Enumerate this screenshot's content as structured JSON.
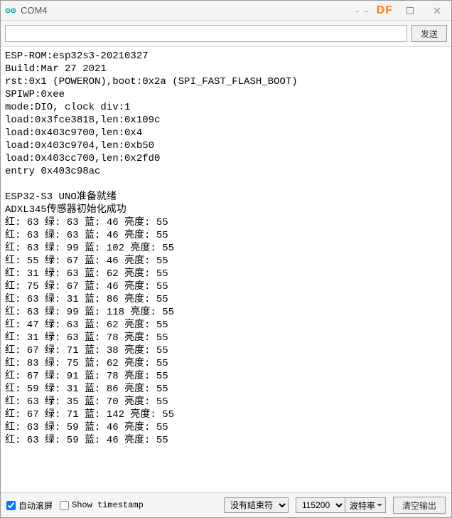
{
  "window": {
    "title": "COM4",
    "watermark": "DF",
    "dashes": "- -"
  },
  "sendRow": {
    "inputValue": "",
    "placeholder": "",
    "sendLabel": "发送"
  },
  "console": {
    "bootLines": [
      "ESP-ROM:esp32s3-20210327",
      "Build:Mar 27 2021",
      "rst:0x1 (POWERON),boot:0x2a (SPI_FAST_FLASH_BOOT)",
      "SPIWP:0xee",
      "mode:DIO, clock div:1",
      "load:0x3fce3818,len:0x109c",
      "load:0x403c9700,len:0x4",
      "load:0x403c9704,len:0xb50",
      "load:0x403cc700,len:0x2fd0",
      "entry 0x403c98ac",
      "",
      "ESP32-S3 UNO准备就绪",
      "ADXL345传感器初始化成功"
    ],
    "labels": {
      "r": "红:",
      "g": "绿:",
      "b": "蓝:",
      "l": "亮度:"
    },
    "readings": [
      {
        "r": 63,
        "g": 63,
        "b": 46,
        "l": 55
      },
      {
        "r": 63,
        "g": 63,
        "b": 46,
        "l": 55
      },
      {
        "r": 63,
        "g": 99,
        "b": 102,
        "l": 55
      },
      {
        "r": 55,
        "g": 67,
        "b": 46,
        "l": 55
      },
      {
        "r": 31,
        "g": 63,
        "b": 62,
        "l": 55
      },
      {
        "r": 75,
        "g": 67,
        "b": 46,
        "l": 55
      },
      {
        "r": 63,
        "g": 31,
        "b": 86,
        "l": 55
      },
      {
        "r": 63,
        "g": 99,
        "b": 118,
        "l": 55
      },
      {
        "r": 47,
        "g": 63,
        "b": 62,
        "l": 55
      },
      {
        "r": 31,
        "g": 63,
        "b": 78,
        "l": 55
      },
      {
        "r": 67,
        "g": 71,
        "b": 38,
        "l": 55
      },
      {
        "r": 83,
        "g": 75,
        "b": 62,
        "l": 55
      },
      {
        "r": 67,
        "g": 91,
        "b": 78,
        "l": 55
      },
      {
        "r": 59,
        "g": 31,
        "b": 86,
        "l": 55
      },
      {
        "r": 63,
        "g": 35,
        "b": 70,
        "l": 55
      },
      {
        "r": 67,
        "g": 71,
        "b": 142,
        "l": 55
      },
      {
        "r": 63,
        "g": 59,
        "b": 46,
        "l": 55
      },
      {
        "r": 63,
        "g": 59,
        "b": 46,
        "l": 55
      }
    ]
  },
  "bottom": {
    "autoscroll": {
      "label": "自动滚屏",
      "checked": true
    },
    "timestamp": {
      "label": "Show timestamp",
      "checked": false
    },
    "lineEnding": {
      "selected": "没有结束符"
    },
    "baud": {
      "selected": "115200",
      "suffix": "波特率"
    },
    "clearLabel": "清空输出"
  }
}
